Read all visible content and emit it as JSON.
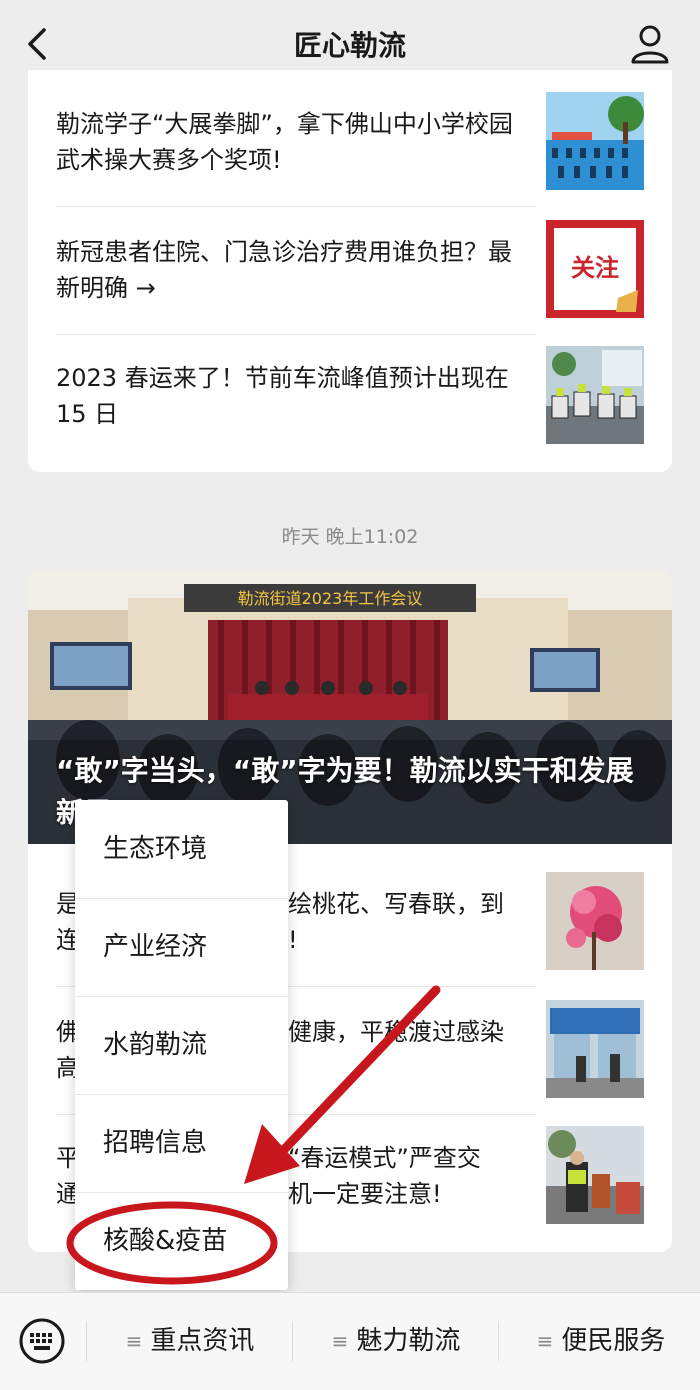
{
  "header": {
    "title": "匠心勒流"
  },
  "card1": {
    "items": [
      {
        "text": "勒流学子“大展拳脚”，拿下佛山中小学校园武术操大赛多个奖项!"
      },
      {
        "text": "新冠患者住院、门急诊治疗费用谁负担？最新明确 →",
        "thumb_label": "关注"
      },
      {
        "text": "2023 春运来了！节前车流峰值预计出现在 15 日"
      }
    ]
  },
  "timestamp": "昨天 晚上11:02",
  "card2": {
    "banner_text": "勒流街道2023年工作会议",
    "hero_title": "“敢”字当头，“敢”字为要！勒流以实干和发展新局",
    "items": [
      {
        "text_left": "是",
        "text_left2": "连",
        "text_right": "绘桃花、写春联，到",
        "text_right2": "!"
      },
      {
        "text_left": "佛",
        "text_left2": "高",
        "text_right": "健康，平稳渡过感染",
        "text_right2": ""
      },
      {
        "text_left": "平",
        "text_left2": "通",
        "text_right": "“春运模式”严查交",
        "text_right2": "机一定要注意!"
      }
    ]
  },
  "popup_menu": {
    "items": [
      "生态环境",
      "产业经济",
      "水韵勒流",
      "招聘信息",
      "核酸&疫苗"
    ],
    "highlighted": "核酸&疫苗",
    "highlight_color": "#c8161d"
  },
  "bottom_menu": {
    "tabs": [
      "重点资讯",
      "魅力勒流",
      "便民服务"
    ]
  }
}
